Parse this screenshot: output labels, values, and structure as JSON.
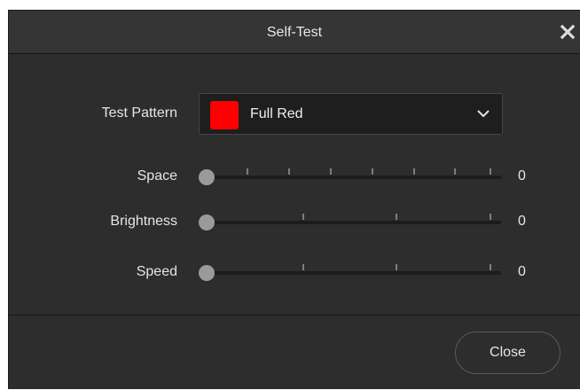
{
  "dialog": {
    "title": "Self-Test",
    "close_icon": "close-x-icon"
  },
  "test_pattern": {
    "label": "Test Pattern",
    "selected": "Full Red",
    "swatch_color": "#ff0000",
    "dropdown_icon": "chevron-down-icon"
  },
  "sliders": [
    {
      "label": "Space",
      "value": "0",
      "ticks": 8
    },
    {
      "label": "Brightness",
      "value": "0",
      "ticks": 4
    },
    {
      "label": "Speed",
      "value": "0",
      "ticks": 4
    }
  ],
  "footer": {
    "close_label": "Close"
  }
}
